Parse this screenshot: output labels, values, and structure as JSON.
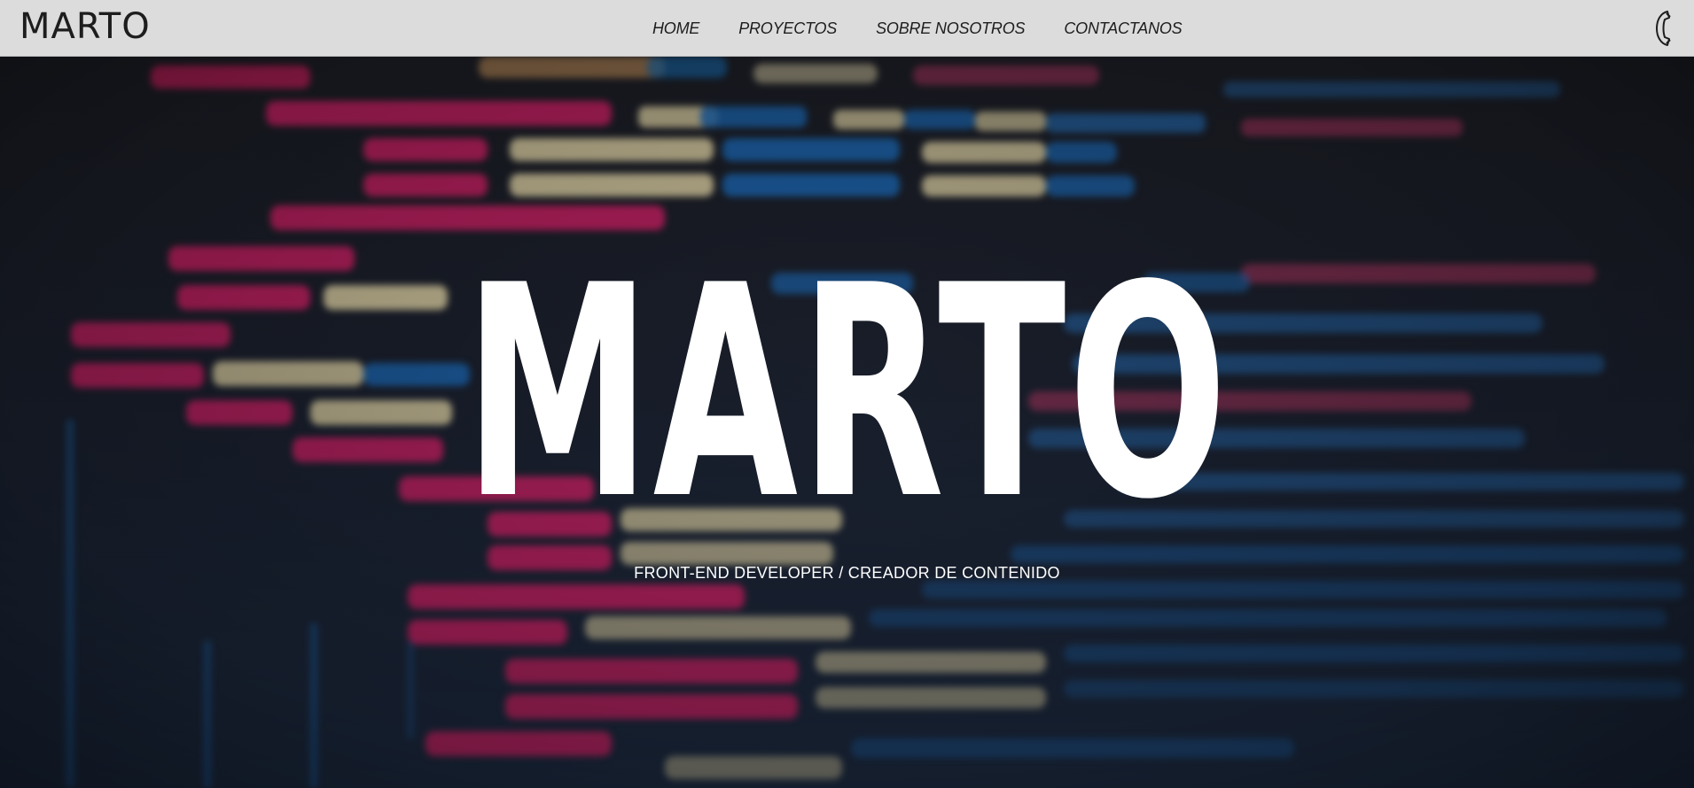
{
  "navbar": {
    "brand": "MARTO",
    "links": [
      "HOME",
      "PROYECTOS",
      "SOBRE NOSOTROS",
      "CONTACTANOS"
    ],
    "phone_icon": "phone-icon"
  },
  "hero": {
    "title": "MARTO",
    "subtitle": "FRONT-END DEVELOPER / CREADOR DE CONTENIDO",
    "background": "code-editor-photo"
  },
  "colors": {
    "navbar_bg": "#dcdcdc",
    "text_dark": "#1d1d1d",
    "tag_pink": "#e6266e",
    "attr_yellow": "#f2e2a0",
    "value_blue": "#1e6fc4",
    "hero_text": "#ffffff"
  }
}
